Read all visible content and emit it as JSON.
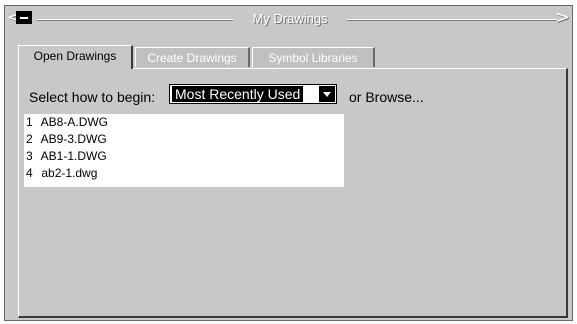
{
  "window": {
    "title": "My Drawings"
  },
  "tabs": [
    {
      "label": "Open Drawings",
      "active": true
    },
    {
      "label": "Create Drawings",
      "active": false
    },
    {
      "label": "Symbol Libraries",
      "active": false
    }
  ],
  "begin": {
    "label": "Select how to begin:",
    "selected": "Most Recently Used",
    "browse": "or Browse..."
  },
  "files": [
    {
      "num": "1",
      "name": "AB8-A.DWG"
    },
    {
      "num": "2",
      "name": "AB9-3.DWG"
    },
    {
      "num": "3",
      "name": "AB1-1.DWG"
    },
    {
      "num": "4",
      "name": "ab2-1.dwg"
    }
  ],
  "icons": {
    "collapse": "minus-icon",
    "title_left": "chevron-left-icon",
    "title_right": "chevron-right-icon",
    "dropdown": "triangle-down-icon"
  },
  "colors": {
    "background": "#c8c8c8",
    "title_text": "#ffffff",
    "selected_bg": "#000000"
  }
}
